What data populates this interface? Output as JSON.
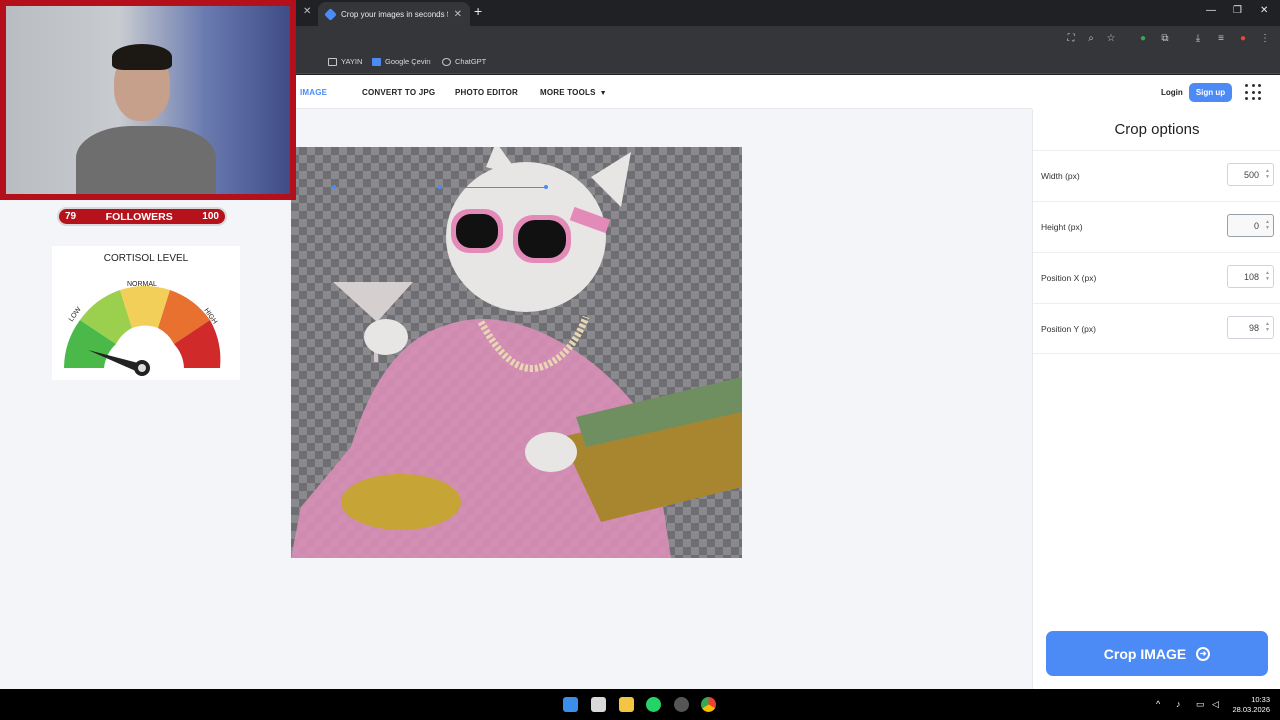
{
  "browser": {
    "active_tab_title": "Crop your images in seconds fo",
    "bookmarks": [
      {
        "label": "YAYIN"
      },
      {
        "label": "Google Çevirı"
      },
      {
        "label": "ChatGPT"
      }
    ]
  },
  "site_nav": {
    "links": [
      {
        "label": "IMAGE",
        "active": true
      },
      {
        "label": "CONVERT TO JPG"
      },
      {
        "label": "PHOTO EDITOR"
      },
      {
        "label": "MORE TOOLS"
      }
    ],
    "login": "Login",
    "signup": "Sign up"
  },
  "crop_panel": {
    "title": "Crop options",
    "options": [
      {
        "label": "Width (px)",
        "value": "500"
      },
      {
        "label": "Height (px)",
        "value": "0"
      },
      {
        "label": "Position X (px)",
        "value": "108"
      },
      {
        "label": "Position Y (px)",
        "value": "98"
      }
    ],
    "button": "Crop IMAGE"
  },
  "overlay": {
    "followers_current": "79",
    "followers_label": "FOLLOWERS",
    "followers_goal": "100",
    "cortisol_title": "CORTISOL LEVEL",
    "gauge_labels": {
      "low": "LOW",
      "normal": "NORMAL",
      "high": "HIGH"
    }
  },
  "taskbar": {
    "time": "10:33",
    "date": "28.03.2026"
  },
  "colors": {
    "accent": "#4c8bf5",
    "overlay_red": "#b5121b"
  }
}
